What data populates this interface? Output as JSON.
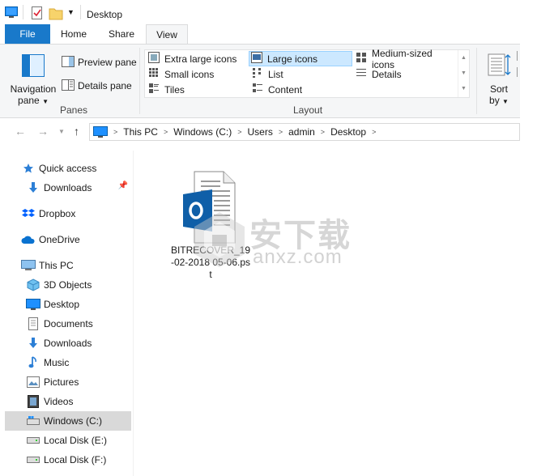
{
  "window": {
    "title": "Desktop"
  },
  "ribbon": {
    "tabs": [
      {
        "label": "File"
      },
      {
        "label": "Home"
      },
      {
        "label": "Share"
      },
      {
        "label": "View"
      }
    ],
    "panes": {
      "navigation_pane_line1": "Navigation",
      "navigation_pane_line2": "pane",
      "preview_pane": "Preview pane",
      "details_pane": "Details pane",
      "group_label": "Panes"
    },
    "layout": {
      "items": [
        {
          "label": "Extra large icons"
        },
        {
          "label": "Large icons"
        },
        {
          "label": "Medium-sized icons"
        },
        {
          "label": "Small icons"
        },
        {
          "label": "List"
        },
        {
          "label": "Details"
        },
        {
          "label": "Tiles"
        },
        {
          "label": "Content"
        }
      ],
      "selected": "Large icons",
      "group_label": "Layout"
    },
    "sort": {
      "line1": "Sort",
      "line2": "by"
    }
  },
  "address": {
    "crumbs": [
      "This PC",
      "Windows (C:)",
      "Users",
      "admin",
      "Desktop"
    ]
  },
  "navpane": {
    "items": [
      {
        "label": "Quick access",
        "icon": "star-icon"
      },
      {
        "label": "Downloads",
        "icon": "download-icon",
        "pinned": true
      },
      {
        "label": "Dropbox",
        "icon": "dropbox-icon"
      },
      {
        "label": "OneDrive",
        "icon": "cloud-icon"
      },
      {
        "label": "This PC",
        "icon": "computer-icon"
      },
      {
        "label": "3D Objects",
        "icon": "cube-icon"
      },
      {
        "label": "Desktop",
        "icon": "desktop-icon"
      },
      {
        "label": "Documents",
        "icon": "document-icon"
      },
      {
        "label": "Downloads",
        "icon": "download-icon"
      },
      {
        "label": "Music",
        "icon": "music-icon"
      },
      {
        "label": "Pictures",
        "icon": "pictures-icon"
      },
      {
        "label": "Videos",
        "icon": "video-icon"
      },
      {
        "label": "Windows (C:)",
        "icon": "drive-icon",
        "selected": true
      },
      {
        "label": "Local Disk (E:)",
        "icon": "drive-icon"
      },
      {
        "label": "Local Disk (F:)",
        "icon": "drive-icon"
      }
    ]
  },
  "content": {
    "files": [
      {
        "name": "BITRECOVER_19-02-2018 05-06.pst",
        "icon": "outlook-pst-icon"
      }
    ]
  },
  "watermark": {
    "cn": "安下载",
    "en": "anxz.com"
  },
  "colors": {
    "accent": "#1979ca",
    "selected_layout": "#cce8ff",
    "selected_nav": "#d9d9d9",
    "outlook_blue": "#0f5fa8"
  }
}
